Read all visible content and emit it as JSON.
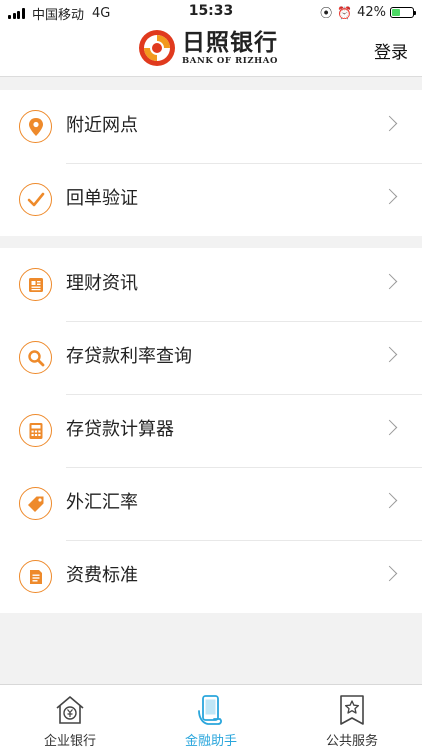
{
  "status_bar": {
    "carrier": "中国移动",
    "network": "4G",
    "time": "15:33",
    "battery_percent": "42%",
    "battery_level": 0.42
  },
  "header": {
    "logo_cn": "日照银行",
    "logo_en": "BANK OF RIZHAO",
    "login_label": "登录"
  },
  "groups": [
    {
      "items": [
        {
          "label": "附近网点",
          "icon": "location-pin-icon"
        },
        {
          "label": "回单验证",
          "icon": "checkmark-icon"
        }
      ]
    },
    {
      "items": [
        {
          "label": "理财资讯",
          "icon": "newspaper-icon"
        },
        {
          "label": "存贷款利率查询",
          "icon": "search-icon"
        },
        {
          "label": "存贷款计算器",
          "icon": "calculator-icon"
        },
        {
          "label": "外汇汇率",
          "icon": "price-tag-icon"
        },
        {
          "label": "资费标准",
          "icon": "document-icon"
        }
      ]
    }
  ],
  "tabs": [
    {
      "label": "企业银行",
      "icon": "house-yen-icon",
      "active": false
    },
    {
      "label": "金融助手",
      "icon": "phone-hand-icon",
      "active": true
    },
    {
      "label": "公共服务",
      "icon": "star-bookmark-icon",
      "active": false
    }
  ],
  "colors": {
    "accent": "#ee8a2b",
    "tab_active": "#2aa6dc",
    "background": "#f2f2f2"
  }
}
